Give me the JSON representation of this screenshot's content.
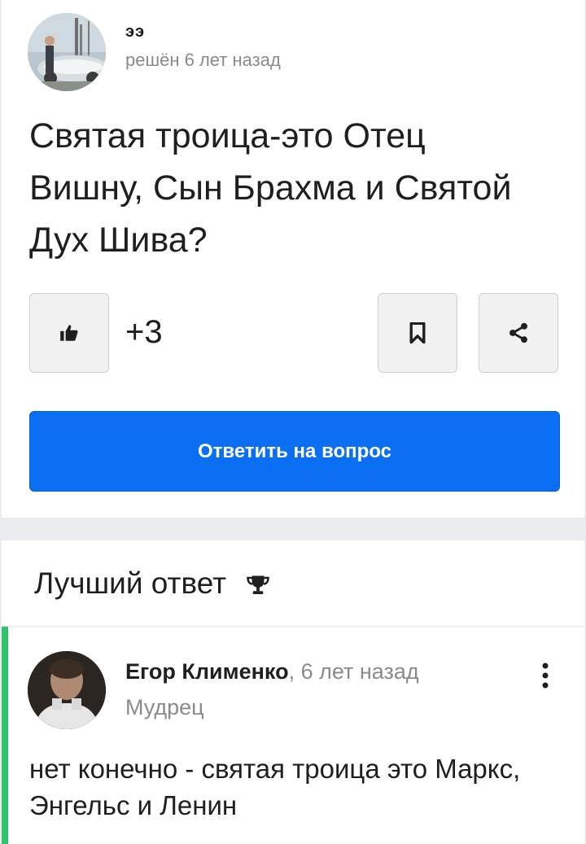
{
  "question": {
    "author_name": "ээ",
    "author_meta": "решён 6 лет назад",
    "title": "Святая троица-это Отец Вишну, Сын Брахма и Святой Дух Шива?",
    "score": "+3",
    "answer_button_label": "Ответить на вопрос",
    "icons": {
      "like": "thumbs-up-icon",
      "bookmark": "bookmark-icon",
      "share": "share-icon"
    }
  },
  "best_answer": {
    "header": "Лучший ответ",
    "header_icon": "trophy-icon",
    "author_name": "Егор Клименко",
    "time": ", 6 лет назад",
    "rank": "Мудрец",
    "text": "нет конечно - святая троица это Маркс, Энгельс и Ленин"
  },
  "colors": {
    "accent": "#0a6ff2",
    "best_answer_bar": "#2ec26a",
    "muted_text": "#8a8a8a"
  }
}
